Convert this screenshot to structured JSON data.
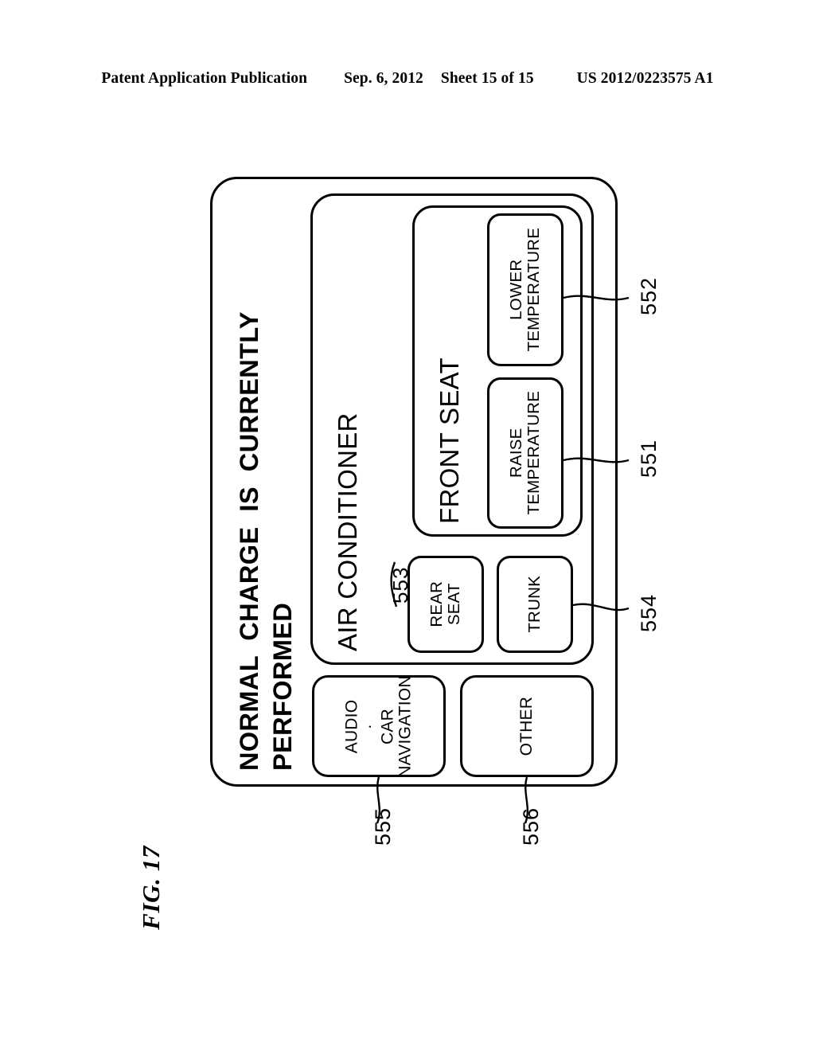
{
  "header": {
    "publication": "Patent Application Publication",
    "date": "Sep. 6, 2012",
    "sheet": "Sheet 15 of 15",
    "patent_number": "US 2012/0223575 A1"
  },
  "figure": {
    "label": "FIG. 17"
  },
  "screen": {
    "status_message": "NORMAL  CHARGE  IS  CURRENTLY\nPERFORMED",
    "aircon_group_label": "AIR CONDITIONER",
    "front_seat_group_label": "FRONT SEAT",
    "buttons": {
      "lower_temperature": "LOWER\nTEMPERATURE",
      "raise_temperature": "RAISE\nTEMPERATURE",
      "rear_seat": "REAR\nSEAT",
      "trunk": "TRUNK",
      "audio_car_navigation": "AUDIO\n·\nCAR\nNAVIGATION",
      "other": "OTHER"
    }
  },
  "reference_numerals": {
    "lower_temperature": "552",
    "raise_temperature": "551",
    "trunk": "554",
    "aircon_group": "553",
    "audio_car_navigation": "555",
    "other": "556"
  }
}
